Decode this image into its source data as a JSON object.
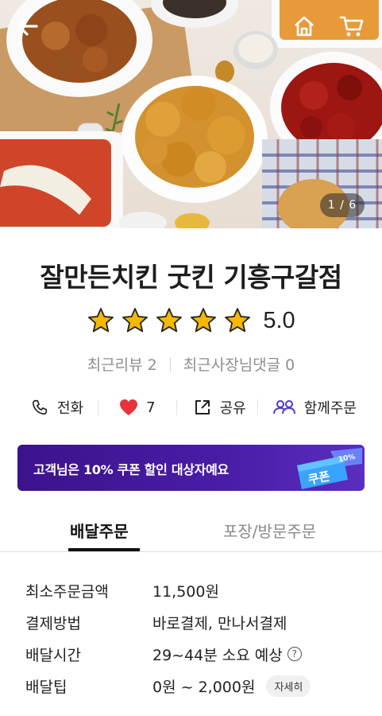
{
  "hero": {
    "image_counter": "1 / 6"
  },
  "store": {
    "name": "잘만든치킨 굿킨 기흥구갈점",
    "rating": 5.0,
    "rating_text": "5.0",
    "stars_filled": 5,
    "recent_reviews": "최근리뷰 2",
    "owner_replies": "최근사장님댓글 0"
  },
  "actions": {
    "call": "전화",
    "likes": "7",
    "share": "공유",
    "group_order": "함께주문"
  },
  "coupon": {
    "text": "고객님은 10% 쿠폰 할인 대상자예요",
    "ticket_label": "쿠폰",
    "ticket_percent": "10%"
  },
  "tabs": [
    {
      "label": "배달주문",
      "active": true
    },
    {
      "label": "포장/방문주문",
      "active": false
    }
  ],
  "info": {
    "min_order_label": "최소주문금액",
    "min_order_value": "11,500원",
    "payment_label": "결제방법",
    "payment_value": "바로결제, 만나서결제",
    "delivery_time_label": "배달시간",
    "delivery_time_value": "29~44분 소요 예상",
    "delivery_tip_label": "배달팁",
    "delivery_tip_value": "0원 ~ 2,000원",
    "detail_button": "자세히"
  },
  "colors": {
    "coupon_bg": "#3c128c",
    "star": "#f5b800",
    "heart": "#e8323c",
    "group_icon": "#4a3ad6"
  },
  "icons": [
    "back-arrow-icon",
    "home-icon",
    "cart-icon",
    "phone-icon",
    "heart-icon",
    "share-icon",
    "group-icon",
    "question-icon"
  ]
}
